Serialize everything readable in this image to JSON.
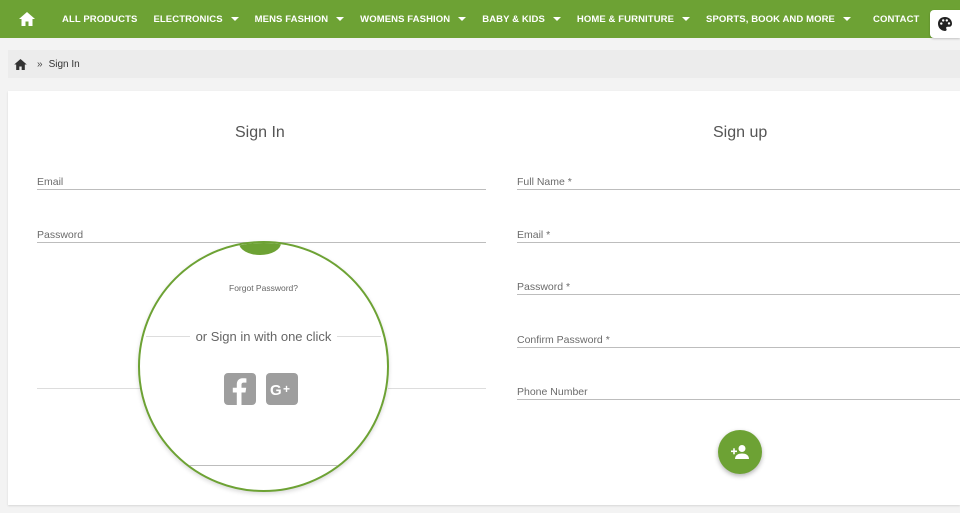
{
  "nav": {
    "items": [
      {
        "label": "ALL PRODUCTS",
        "dropdown": false
      },
      {
        "label": "ELECTRONICS",
        "dropdown": true
      },
      {
        "label": "MENS FASHION",
        "dropdown": true
      },
      {
        "label": "WOMENS FASHION",
        "dropdown": true
      },
      {
        "label": "BABY & KIDS",
        "dropdown": true
      },
      {
        "label": "HOME & FURNITURE",
        "dropdown": true
      },
      {
        "label": "SPORTS, BOOK AND MORE",
        "dropdown": true
      },
      {
        "label": "CONTACT",
        "dropdown": false
      }
    ],
    "home_icon": "home-icon",
    "palette_icon": "palette-icon"
  },
  "breadcrumb": {
    "home_icon": "home-icon",
    "separator": "»",
    "current": "Sign In"
  },
  "signin": {
    "title": "Sign In",
    "email_placeholder": "Email",
    "password_placeholder": "Password",
    "forgot": "Forgot Password?",
    "one_click": "or Sign in with one click",
    "facebook_icon": "facebook-icon",
    "google_plus_icon": "google-plus-icon"
  },
  "signup": {
    "title": "Sign up",
    "full_name_placeholder": "Full Name *",
    "email_placeholder": "Email *",
    "password_placeholder": "Password *",
    "confirm_password_placeholder": "Confirm Password *",
    "phone_placeholder": "Phone Number",
    "submit_icon": "add-user-icon"
  },
  "colors": {
    "accent": "#6da234",
    "social_gray": "#9e9e9e"
  }
}
